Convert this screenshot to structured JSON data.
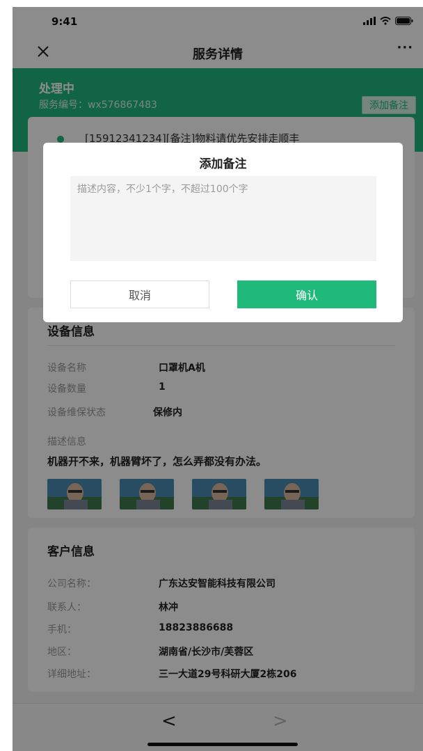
{
  "status_bar": {
    "time": "9:41"
  },
  "nav": {
    "title": "服务详情",
    "more": "···"
  },
  "header": {
    "status": "处理中",
    "service_no": "服务编号：wx576867483",
    "add_note": "添加备注"
  },
  "log": {
    "text": "[15912341234][备注]物料请优先安排走顺丰"
  },
  "device": {
    "title": "设备信息",
    "rows": [
      {
        "label": "设备名称",
        "value": "口罩机A机"
      },
      {
        "label": "设备数量",
        "value": "1"
      },
      {
        "label": "设备维保状态",
        "value": "保修内"
      }
    ],
    "desc_label": "描述信息",
    "desc_text": "机器开不来，机器臂坏了，怎么弄都没有办法。"
  },
  "customer": {
    "title": "客户信息",
    "rows": [
      {
        "label": "公司名称：",
        "value": "广东达安智能科技有限公司"
      },
      {
        "label": "联系人：",
        "value": "林冲"
      },
      {
        "label": "手机：",
        "value": "18823886688"
      },
      {
        "label": "地区：",
        "value": "湖南省/长沙市/芙蓉区"
      },
      {
        "label": "详细地址：",
        "value": "三一大道29号科研大厦2栋206"
      }
    ]
  },
  "bottom": {
    "back": "<",
    "forward": ">"
  },
  "dialog": {
    "title": "添加备注",
    "placeholder": "描述内容，不少1个字，不超过100个字",
    "value": "",
    "cancel": "取消",
    "confirm": "确认"
  },
  "colors": {
    "accent": "#1fb97c"
  }
}
